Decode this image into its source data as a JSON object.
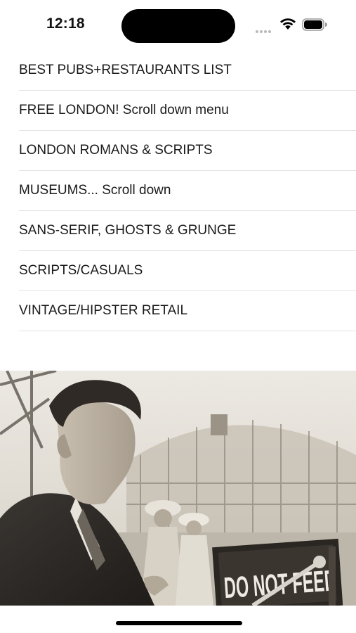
{
  "status_bar": {
    "time": "12:18"
  },
  "menu": {
    "items": [
      {
        "label": "BEST PUBS+RESTAURANTS LIST"
      },
      {
        "label": "FREE LONDON! Scroll down menu"
      },
      {
        "label": "LONDON ROMANS & SCRIPTS"
      },
      {
        "label": "MUSEUMS... Scroll down"
      },
      {
        "label": "SANS-SERIF, GHOSTS & GRUNGE"
      },
      {
        "label": "SCRIPTS/CASUALS"
      },
      {
        "label": "VINTAGE/HIPSTER RETAIL"
      }
    ]
  },
  "photo": {
    "sign_text": "DO NOT FEED",
    "tone": "#d9d3c8"
  }
}
